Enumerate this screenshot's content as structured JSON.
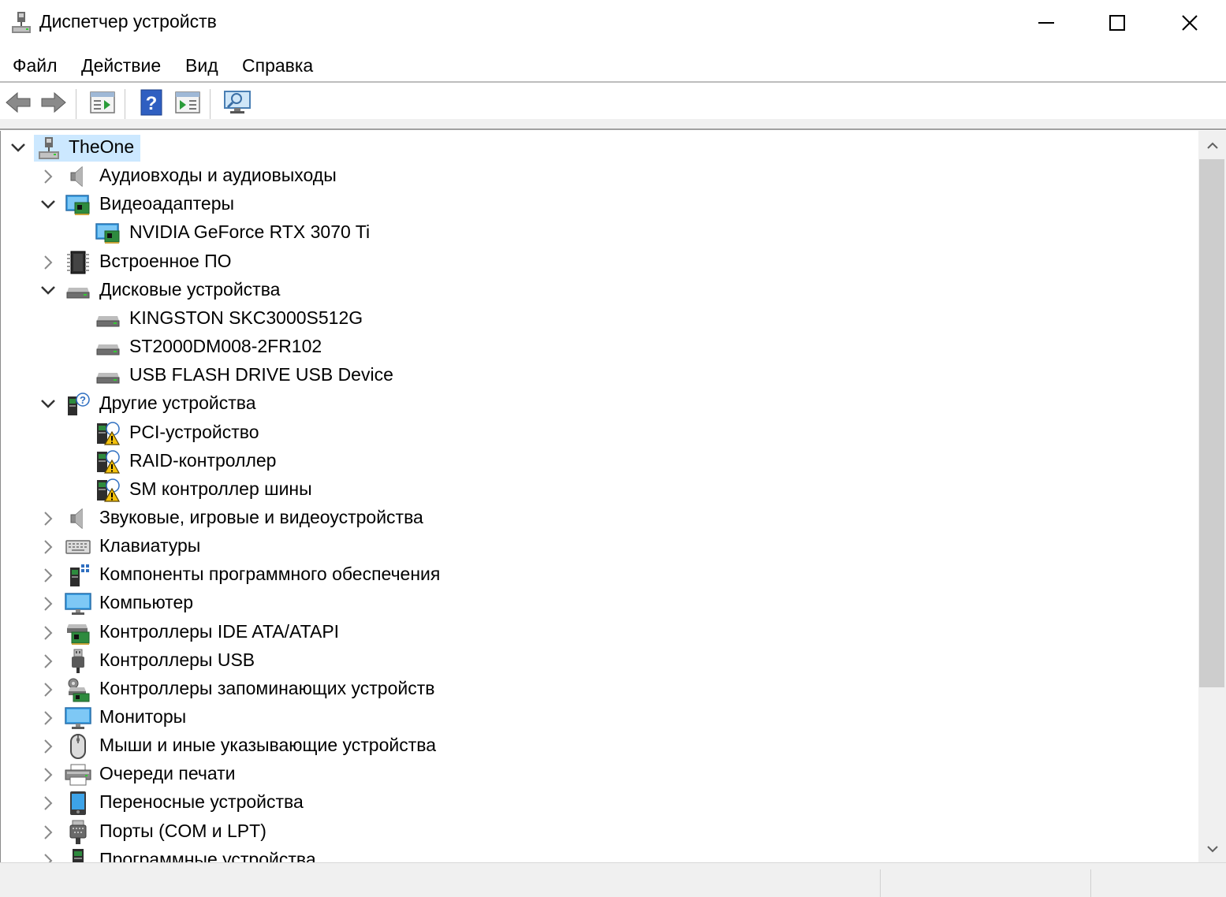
{
  "window": {
    "title": "Диспетчер устройств"
  },
  "menu": [
    "Файл",
    "Действие",
    "Вид",
    "Справка"
  ],
  "toolbar": {
    "buttons": [
      "back-arrow-icon",
      "forward-arrow-icon",
      "properties-icon",
      "help-icon",
      "update-driver-icon",
      "scan-hardware-icon"
    ]
  },
  "tree": {
    "root": "TheOne",
    "items": [
      {
        "label": "Аудиовходы и аудиовыходы",
        "expanded": false,
        "icon": "speaker-icon"
      },
      {
        "label": "Видеоадаптеры",
        "expanded": true,
        "icon": "display-adapter-icon",
        "children": [
          {
            "label": "NVIDIA GeForce RTX 3070 Ti",
            "icon": "display-adapter-icon"
          }
        ]
      },
      {
        "label": "Встроенное ПО",
        "expanded": false,
        "icon": "firmware-chip-icon"
      },
      {
        "label": "Дисковые устройства",
        "expanded": true,
        "icon": "disk-drive-icon",
        "children": [
          {
            "label": "KINGSTON SKC3000S512G",
            "icon": "disk-drive-icon"
          },
          {
            "label": "ST2000DM008-2FR102",
            "icon": "disk-drive-icon"
          },
          {
            "label": "USB FLASH DRIVE USB Device",
            "icon": "disk-drive-icon"
          }
        ]
      },
      {
        "label": "Другие устройства",
        "expanded": true,
        "icon": "unknown-device-icon",
        "children": [
          {
            "label": "PCI-устройство",
            "icon": "warning-device-icon"
          },
          {
            "label": "RAID-контроллер",
            "icon": "warning-device-icon"
          },
          {
            "label": "SM контроллер шины",
            "icon": "warning-device-icon"
          }
        ]
      },
      {
        "label": "Звуковые, игровые и видеоустройства",
        "expanded": false,
        "icon": "speaker-icon"
      },
      {
        "label": "Клавиатуры",
        "expanded": false,
        "icon": "keyboard-icon"
      },
      {
        "label": "Компоненты программного обеспечения",
        "expanded": false,
        "icon": "software-component-icon"
      },
      {
        "label": "Компьютер",
        "expanded": false,
        "icon": "monitor-icon"
      },
      {
        "label": "Контроллеры IDE ATA/ATAPI",
        "expanded": false,
        "icon": "ide-controller-icon"
      },
      {
        "label": "Контроллеры USB",
        "expanded": false,
        "icon": "usb-icon"
      },
      {
        "label": "Контроллеры запоминающих устройств",
        "expanded": false,
        "icon": "storage-controller-icon"
      },
      {
        "label": "Мониторы",
        "expanded": false,
        "icon": "monitor-icon"
      },
      {
        "label": "Мыши и иные указывающие устройства",
        "expanded": false,
        "icon": "mouse-icon"
      },
      {
        "label": "Очереди печати",
        "expanded": false,
        "icon": "printer-icon"
      },
      {
        "label": "Переносные устройства",
        "expanded": false,
        "icon": "portable-device-icon"
      },
      {
        "label": "Порты (COM и LPT)",
        "expanded": false,
        "icon": "port-icon"
      },
      {
        "label": "Программные устройства",
        "expanded": false,
        "icon": "software-device-icon"
      }
    ]
  },
  "colors": {
    "selection": "#cce8ff",
    "scrollbar_track": "#f0f0f0",
    "scrollbar_thumb": "#cdcdcd",
    "statusbar": "#f0f0f0"
  }
}
